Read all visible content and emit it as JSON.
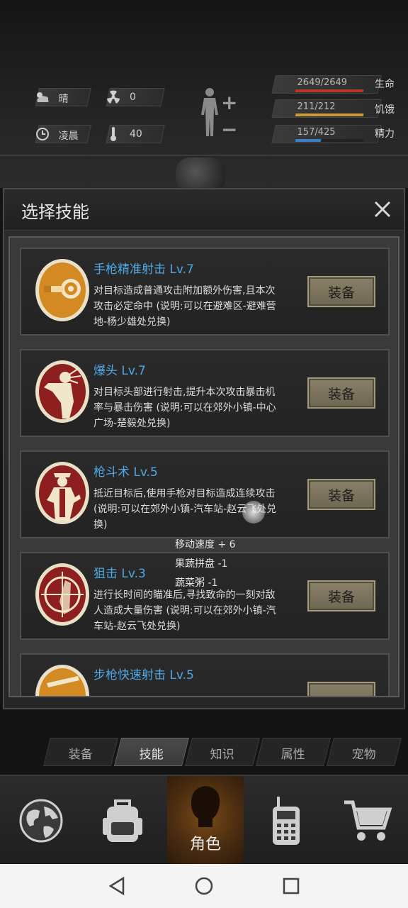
{
  "status": {
    "weather": "晴",
    "radiation": "0",
    "time_of_day": "凌晨",
    "temperature": "40",
    "vitals": [
      {
        "value": "2649/2649",
        "label": "生命",
        "fill": 1.0,
        "color": "#b8352b"
      },
      {
        "value": "211/212",
        "label": "饥饿",
        "fill": 0.995,
        "color": "#c89a3a"
      },
      {
        "value": "157/425",
        "label": "精力",
        "fill": 0.37,
        "color": "#3a7ec9"
      }
    ]
  },
  "dialog": {
    "title": "选择技能",
    "skills": [
      {
        "name": "手枪精准射击 Lv.7",
        "desc": "对目标造成普通攻击附加额外伤害,且本次攻击必定命中 (说明:可以在避难区-避难营地-杨少雄处兑换)",
        "button": "装备",
        "icon": "pistol-precision-icon"
      },
      {
        "name": "爆头 Lv.7",
        "desc": "对目标头部进行射击,提升本次攻击暴击机率与暴击伤害 (说明:可以在郊外小镇-中心广场-楚毅处兑换)",
        "button": "装备",
        "icon": "headshot-icon"
      },
      {
        "name": "枪斗术 Lv.5",
        "desc": "抵近目标后,使用手枪对目标造成连续攻击 (说明:可以在郊外小镇-汽车站-赵云飞处兑换)",
        "button": "装备",
        "icon": "gun-kata-icon"
      },
      {
        "name": "狙击 Lv.3",
        "desc": "进行长时间的瞄准后,寻找致命的一刻对敌人造成大量伤害 (说明:可以在郊外小镇-汽车站-赵云飞处兑换)",
        "button": "装备",
        "icon": "sniper-icon"
      },
      {
        "name": "步枪快速射击 Lv.5",
        "desc": "",
        "button": "",
        "icon": "rifle-rapid-icon"
      }
    ]
  },
  "floating_texts": [
    "移动速度 + 6",
    "果蔬拼盘 -1",
    "蔬菜粥 -1"
  ],
  "tabs": [
    "装备",
    "技能",
    "知识",
    "属性",
    "宠物"
  ],
  "active_tab": "技能",
  "bottom_nav": {
    "active_label": "角色"
  }
}
